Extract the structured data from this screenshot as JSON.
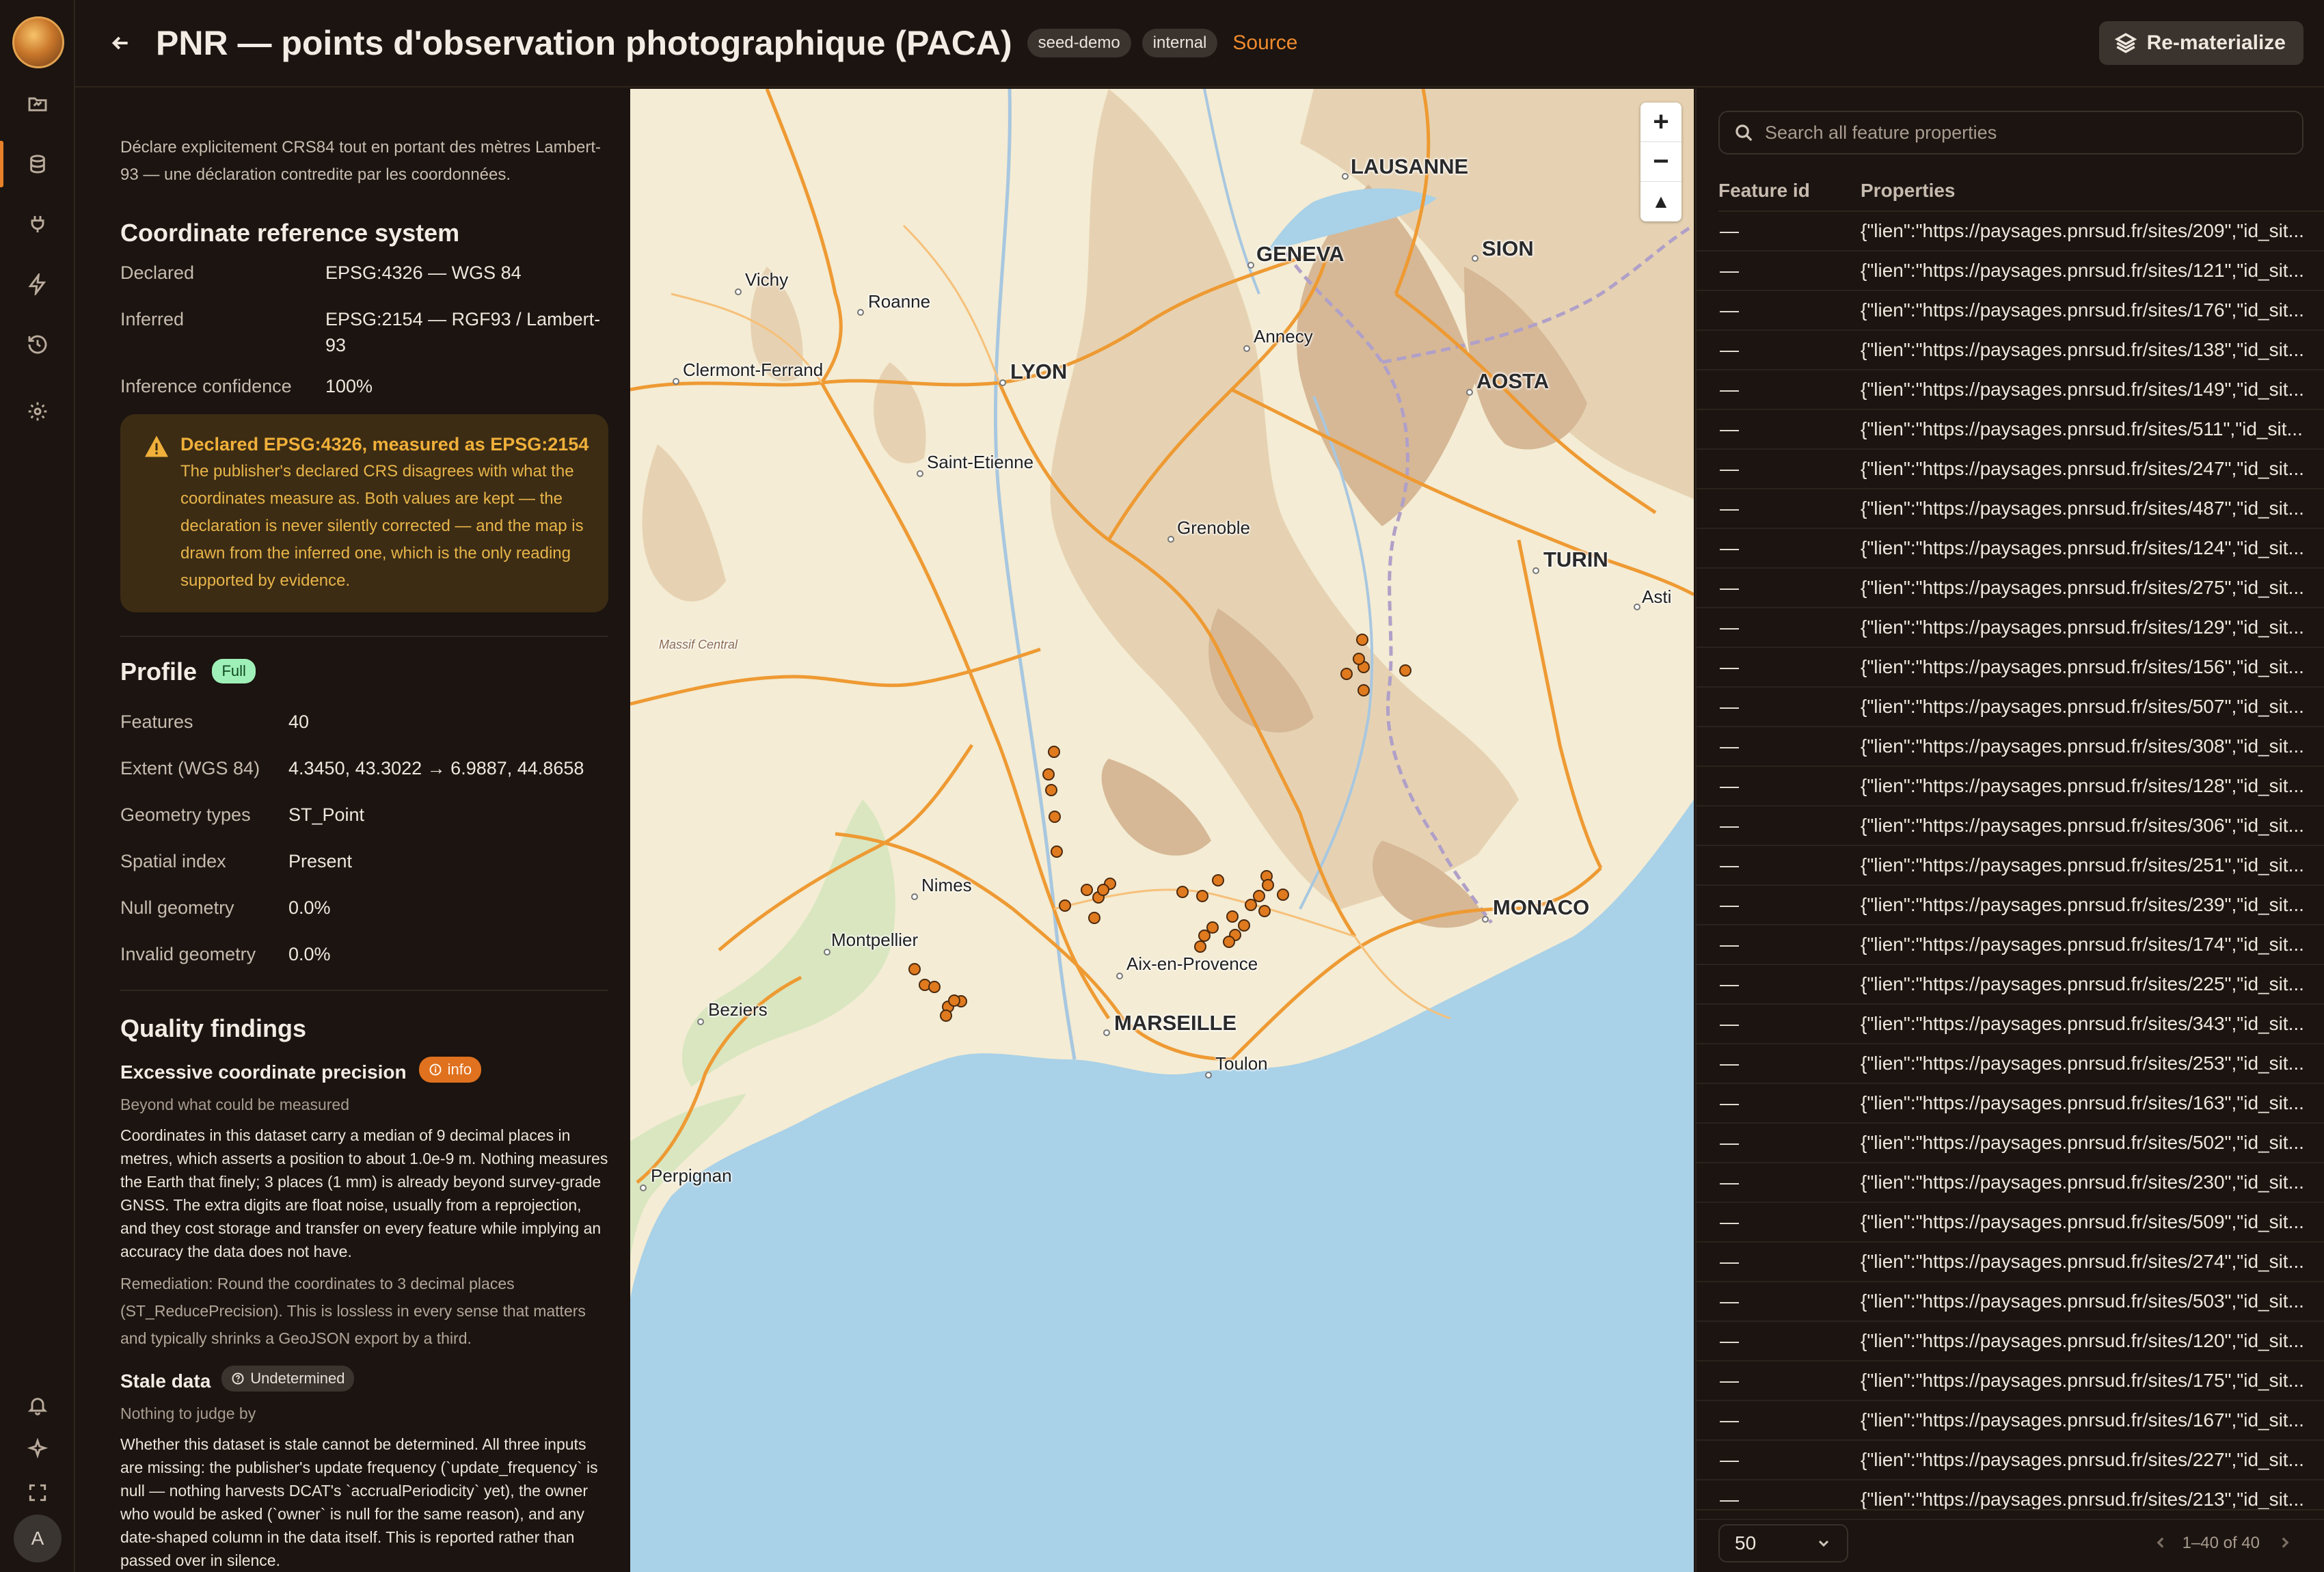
{
  "header": {
    "title": "PNR — points d'observation photographique (PACA)",
    "tags": [
      "seed-demo",
      "internal"
    ],
    "source_link": "Source",
    "rematerialize_label": "Re-materialize"
  },
  "user": {
    "avatar_initial": "A"
  },
  "panel": {
    "intro": "Déclare explicitement CRS84 tout en portant des mètres Lambert-93 — une déclaration contredite par les coordonnées.",
    "crs": {
      "heading": "Coordinate reference system",
      "declared_label": "Declared",
      "declared_value": "EPSG:4326 — WGS 84",
      "inferred_label": "Inferred",
      "inferred_value": "EPSG:2154 — RGF93 / Lambert-93",
      "confidence_label": "Inference confidence",
      "confidence_value": "100%",
      "warning_title": "Declared EPSG:4326, measured as EPSG:2154",
      "warning_body": "The publisher's declared CRS disagrees with what the coordinates measure as. Both values are kept — the declaration is never silently corrected — and the map is drawn from the inferred one, which is the only reading supported by evidence."
    },
    "profile": {
      "heading": "Profile",
      "badge": "Full",
      "rows": [
        {
          "label": "Features",
          "value": "40"
        },
        {
          "label": "Extent (WGS 84)",
          "value": "4.3450, 43.3022 → 6.9887, 44.8658"
        },
        {
          "label": "Geometry types",
          "value": "ST_Point"
        },
        {
          "label": "Spatial index",
          "value": "Present"
        },
        {
          "label": "Null geometry",
          "value": "0.0%"
        },
        {
          "label": "Invalid geometry",
          "value": "0.0%"
        }
      ]
    },
    "quality": {
      "heading": "Quality findings",
      "findings": [
        {
          "title": "Excessive coordinate precision",
          "badge": "info",
          "subtitle": "Beyond what could be measured",
          "body": "Coordinates in this dataset carry a median of 9 decimal places in metres, which asserts a position to about 1.0e-9 m. Nothing measures the Earth that finely; 3 places (1 mm) is already beyond survey-grade GNSS. The extra digits are float noise, usually from a reprojection, and they cost storage and transfer on every feature while implying an accuracy the data does not have.",
          "remediation": "Remediation: Round the coordinates to 3 decimal places (ST_ReducePrecision). This is lossless in every sense that matters and typically shrinks a GeoJSON export by a third."
        },
        {
          "title": "Stale data",
          "badge": "Undetermined",
          "subtitle": "Nothing to judge by",
          "body": "Whether this dataset is stale cannot be determined. All three inputs are missing: the publisher's update frequency (`update_frequency` is null — nothing harvests DCAT's `accrualPeriodicity` yet), the owner who would be asked (`owner` is null for the same reason), and any date-shaped column in the data itself. This is reported rather than passed over in silence."
        }
      ]
    }
  },
  "map": {
    "zoom_in": "+",
    "zoom_out": "−",
    "reset": "▲",
    "labels": [
      "LAUSANNE",
      "GENEVA",
      "SION",
      "Vichy",
      "Roanne",
      "Annecy",
      "AOSTA",
      "Clermont-Ferrand",
      "LYON",
      "Saint-Etienne",
      "Grenoble",
      "TURIN",
      "Asti",
      "Massif Central",
      "Nimes",
      "MONACO",
      "Montpellier",
      "Aix-en-Provence",
      "Beziers",
      "MARSEILLE",
      "Toulon",
      "Perpignan"
    ],
    "marker_color": "#e07a1f"
  },
  "table": {
    "search_placeholder": "Search all feature properties",
    "col_id": "Feature id",
    "col_props": "Properties",
    "site_ids": [
      209,
      121,
      176,
      138,
      149,
      511,
      247,
      487,
      124,
      275,
      129,
      156,
      507,
      308,
      128,
      306,
      251,
      239,
      174,
      225,
      343,
      253,
      163,
      502,
      230,
      509,
      274,
      503,
      120,
      175,
      167,
      227,
      213
    ],
    "row_id": "—",
    "row_prefix": "{\"lien\":\"https://paysages.pnrsud.fr/sites/",
    "row_suffix": "\",\"id_sit...",
    "page_size": "50",
    "page_info": "1–40 of 40"
  },
  "colors": {
    "accent": "#e8812a",
    "background": "#1b1410",
    "warning": "#f0b03a"
  }
}
